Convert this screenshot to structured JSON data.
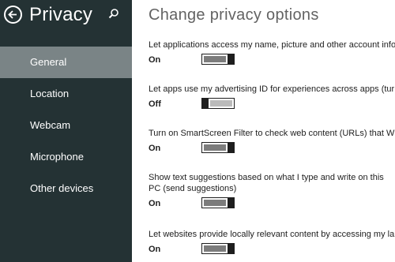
{
  "sidebar": {
    "title": "Privacy",
    "items": [
      {
        "label": "General",
        "selected": true
      },
      {
        "label": "Location",
        "selected": false
      },
      {
        "label": "Webcam",
        "selected": false
      },
      {
        "label": "Microphone",
        "selected": false
      },
      {
        "label": "Other devices",
        "selected": false
      }
    ]
  },
  "main": {
    "title": "Change privacy options",
    "settings": [
      {
        "text": "Let applications access my name, picture and other account info",
        "state": "On"
      },
      {
        "text": "Let apps use my advertising ID for experiences across apps (turn",
        "state": "Off"
      },
      {
        "text": "Turn on SmartScreen Filter to check web content (URLs) that Windows",
        "state": "On"
      },
      {
        "text": "Show text suggestions based on what I type and write on this PC (send suggestions)",
        "state": "On"
      },
      {
        "text": "Let websites provide locally relevant content by accessing my language list",
        "state": "On"
      }
    ]
  },
  "colors": {
    "sidebar_bg": "#243234",
    "selected_bg": "#7a8486",
    "title_text": "#636363",
    "toggle_on_track": "#7c7c7c",
    "toggle_off_track": "#bbbbbb"
  },
  "icons": {
    "back": "back-arrow-icon",
    "search": "search-icon"
  }
}
